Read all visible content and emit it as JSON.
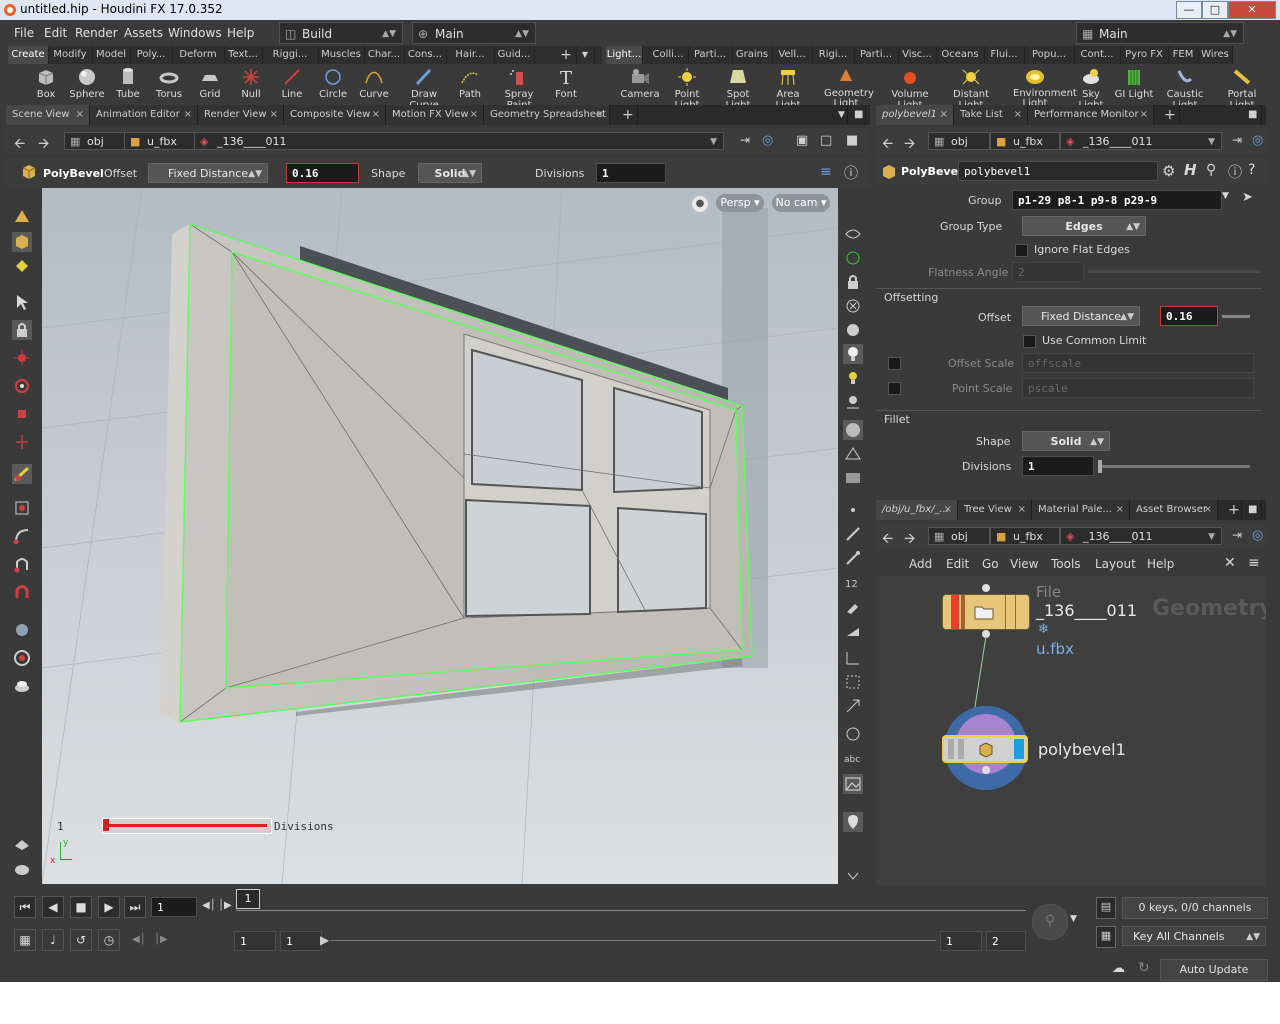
{
  "window": {
    "title": "untitled.hip - Houdini FX 17.0.352",
    "controls": [
      "—",
      "□",
      "✕"
    ]
  },
  "menubar": {
    "items": [
      "File",
      "Edit",
      "Render",
      "Assets",
      "Windows",
      "Help"
    ],
    "desktop": "Build",
    "context": "Main",
    "right_context": "Main"
  },
  "shelf_left": {
    "tabs": [
      "Create",
      "Modify",
      "Model",
      "Poly...",
      "Deform",
      "Text...",
      "Riggi...",
      "Muscles",
      "Char...",
      "Cons...",
      "Hair...",
      "Guid..."
    ],
    "tools": [
      "Box",
      "Sphere",
      "Tube",
      "Torus",
      "Grid",
      "Null",
      "Line",
      "Circle",
      "Curve",
      "Draw Curve",
      "Path",
      "Spray Paint",
      "Font"
    ]
  },
  "shelf_right": {
    "tabs": [
      "Light...",
      "Colli...",
      "Parti...",
      "Grains",
      "Vell...",
      "Rigi...",
      "Parti...",
      "Visc...",
      "Oceans",
      "Flui...",
      "Popu...",
      "Cont...",
      "Pyro FX",
      "FEM",
      "Wires"
    ],
    "tools": [
      "Camera",
      "Point Light",
      "Spot Light",
      "Area Light",
      "Geometry Light",
      "Volume Light",
      "Distant Light",
      "Environment Light",
      "Sky Light",
      "GI Light",
      "Caustic Light",
      "Portal Light"
    ]
  },
  "viewer_tabs": [
    "Scene View",
    "Animation Editor",
    "Render View",
    "Composite View",
    "Motion FX View",
    "Geometry Spreadsheet"
  ],
  "viewer_path": {
    "obj": "obj",
    "fbx": "u_fbx",
    "node": "_136____011"
  },
  "tool_bar": {
    "tool_name": "PolyBevel",
    "offset_label": "Offset",
    "offset_mode": "Fixed Distance",
    "offset_value": "0.16",
    "shape_label": "Shape",
    "shape_value": "Solid",
    "divisions_label": "Divisions",
    "divisions_value": "1"
  },
  "viewport": {
    "persp": "Persp",
    "cam": "No cam",
    "handle_value": "1",
    "handle_label": "Divisions",
    "axis_x": "x",
    "axis_y": "y"
  },
  "param_tabs": [
    "polybevel1",
    "Take List",
    "Performance Monitor"
  ],
  "param_path": {
    "obj": "obj",
    "fbx": "u_fbx",
    "node": "_136____011"
  },
  "params": {
    "node_type": "PolyBevel",
    "node_name": "polybevel1",
    "group_label": "Group",
    "group_value": "p1-29 p8-1 p9-8 p29-9",
    "group_type_label": "Group Type",
    "group_type_value": "Edges",
    "ignore_flat_label": "Ignore Flat Edges",
    "flatness_label": "Flatness Angle",
    "flatness_value": "2",
    "offsetting_section": "Offsetting",
    "offset_label": "Offset",
    "offset_mode": "Fixed Distance",
    "offset_value": "0.16",
    "common_limit_label": "Use Common Limit",
    "offset_scale_label": "Offset Scale",
    "offset_scale_value": "offscale",
    "point_scale_label": "Point Scale",
    "point_scale_value": "pscale",
    "fillet_section": "Fillet",
    "shape_label": "Shape",
    "shape_value": "Solid",
    "divisions_label": "Divisions",
    "divisions_value": "1"
  },
  "network_tabs": [
    "/obj/u_fbx/_...",
    "Tree View",
    "Material Pale...",
    "Asset Browser"
  ],
  "network_path": {
    "obj": "obj",
    "fbx": "u_fbx",
    "node": "_136____011"
  },
  "network_menu": [
    "Add",
    "Edit",
    "Go",
    "View",
    "Tools",
    "Layout",
    "Help"
  ],
  "network": {
    "watermark": "Geometry",
    "file_node_type": "File",
    "file_node_name": "_136____011",
    "file_node_sub": "u.fbx",
    "bevel_node_name": "polybevel1"
  },
  "timeline": {
    "current_frame": "1",
    "marker": "1",
    "start_a": "1",
    "start_b": "1",
    "end_a": "1",
    "end_b": "2",
    "keys_info": "0 keys, 0/0 channels",
    "key_all": "Key All Channels",
    "auto_update": "Auto Update"
  }
}
